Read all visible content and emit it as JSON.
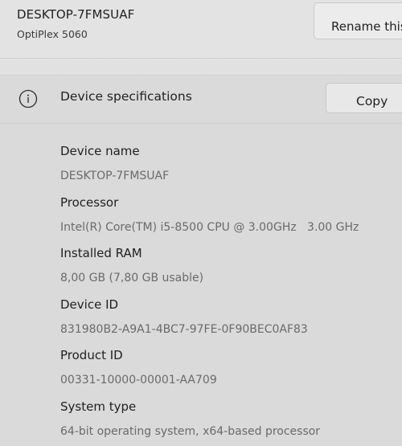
{
  "header": {
    "device_title": "DESKTOP-7FMSUAF",
    "device_model": "OptiPlex 5060",
    "rename_label": "Rename this PC"
  },
  "specs": {
    "title": "Device specifications",
    "copy_label": "Copy",
    "icon": "info-icon",
    "items": [
      {
        "label": "Device name",
        "value": "DESKTOP-7FMSUAF"
      },
      {
        "label": "Processor",
        "value": "Intel(R) Core(TM) i5-8500 CPU @ 3.00GHz   3.00 GHz"
      },
      {
        "label": "Installed RAM",
        "value": "8,00 GB (7,80 GB usable)"
      },
      {
        "label": "Device ID",
        "value": "831980B2-A9A1-4BC7-97FE-0F90BEC0AF83"
      },
      {
        "label": "Product ID",
        "value": "00331-10000-00001-AA709"
      },
      {
        "label": "System type",
        "value": "64-bit operating system, x64-based processor"
      }
    ]
  }
}
